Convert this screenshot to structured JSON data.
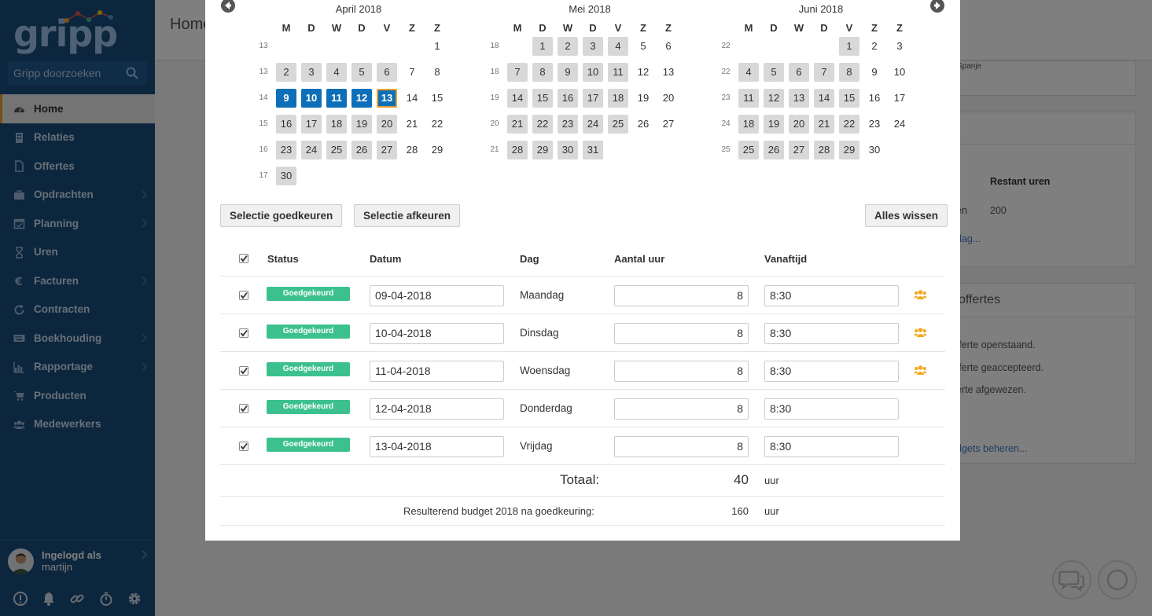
{
  "app": {
    "logo": "gripp",
    "search_placeholder": "Gripp doorzoeken"
  },
  "sidebar": {
    "items": [
      {
        "label": "Home",
        "icon": "dashboard-icon",
        "active": true
      },
      {
        "label": "Relaties",
        "icon": "building-icon"
      },
      {
        "label": "Offertes",
        "icon": "file-icon"
      },
      {
        "label": "Opdrachten",
        "icon": "briefcase-icon",
        "has_sub": true
      },
      {
        "label": "Planning",
        "icon": "calendar-icon",
        "has_sub": true
      },
      {
        "label": "Uren",
        "icon": "hourglass-icon"
      },
      {
        "label": "Facturen",
        "icon": "euro-icon",
        "has_sub": true
      },
      {
        "label": "Contracten",
        "icon": "refresh-icon"
      },
      {
        "label": "Boekhouding",
        "icon": "keyboard-icon",
        "has_sub": true
      },
      {
        "label": "Rapportage",
        "icon": "bar-chart-icon",
        "has_sub": true
      },
      {
        "label": "Producten",
        "icon": "cart-icon"
      },
      {
        "label": "Medewerkers",
        "icon": "users-icon"
      }
    ],
    "user": {
      "line1": "Ingelogd als",
      "line2": "martijn"
    },
    "bottom_icons": [
      "exclamation-icon",
      "bell-icon",
      "link-icon",
      "stopwatch-icon",
      "gear-icon"
    ]
  },
  "background": {
    "page_title": "Home",
    "snippets": {
      "spanje": "Spanje",
      "restant_header": "Restant uren",
      "en": "en",
      "restant_value": "200",
      "dag_link": "dag...",
      "offertes_title": "offertes",
      "open": "fferte openstaand.",
      "accepted": "fferte geaccepteerd.",
      "rejected": "erte afgewezen.",
      "budgets_link": "dgets beheren..."
    }
  },
  "calendars": [
    {
      "title": "April 2018",
      "dow": [
        "M",
        "D",
        "W",
        "D",
        "V",
        "Z",
        "Z"
      ],
      "weeks": [
        {
          "wk": "13",
          "days": [
            null,
            null,
            null,
            null,
            null,
            null,
            {
              "d": "1"
            }
          ]
        },
        {
          "wk": "13",
          "days": [
            {
              "d": "2",
              "s": "g"
            },
            {
              "d": "3",
              "s": "g"
            },
            {
              "d": "4",
              "s": "g"
            },
            {
              "d": "5",
              "s": "g"
            },
            {
              "d": "6",
              "s": "g"
            },
            {
              "d": "7"
            },
            {
              "d": "8"
            }
          ]
        },
        {
          "wk": "14",
          "days": [
            {
              "d": "9",
              "s": "sel"
            },
            {
              "d": "10",
              "s": "sel"
            },
            {
              "d": "11",
              "s": "sel"
            },
            {
              "d": "12",
              "s": "sel"
            },
            {
              "d": "13",
              "s": "cur"
            },
            {
              "d": "14"
            },
            {
              "d": "15"
            }
          ]
        },
        {
          "wk": "15",
          "days": [
            {
              "d": "16",
              "s": "g"
            },
            {
              "d": "17",
              "s": "g"
            },
            {
              "d": "18",
              "s": "g"
            },
            {
              "d": "19",
              "s": "g"
            },
            {
              "d": "20",
              "s": "g"
            },
            {
              "d": "21"
            },
            {
              "d": "22"
            }
          ]
        },
        {
          "wk": "16",
          "days": [
            {
              "d": "23",
              "s": "g"
            },
            {
              "d": "24",
              "s": "g"
            },
            {
              "d": "25",
              "s": "g"
            },
            {
              "d": "26",
              "s": "g"
            },
            {
              "d": "27",
              "s": "g"
            },
            {
              "d": "28"
            },
            {
              "d": "29"
            }
          ]
        },
        {
          "wk": "17",
          "days": [
            {
              "d": "30",
              "s": "g"
            }
          ]
        }
      ]
    },
    {
      "title": "Mei 2018",
      "dow": [
        "M",
        "D",
        "W",
        "D",
        "V",
        "Z",
        "Z"
      ],
      "weeks": [
        {
          "wk": "18",
          "days": [
            null,
            {
              "d": "1",
              "s": "g"
            },
            {
              "d": "2",
              "s": "g"
            },
            {
              "d": "3",
              "s": "g"
            },
            {
              "d": "4",
              "s": "g"
            },
            {
              "d": "5"
            },
            {
              "d": "6"
            }
          ]
        },
        {
          "wk": "18",
          "days": [
            {
              "d": "7",
              "s": "g"
            },
            {
              "d": "8",
              "s": "g"
            },
            {
              "d": "9",
              "s": "g"
            },
            {
              "d": "10",
              "s": "g"
            },
            {
              "d": "11",
              "s": "g"
            },
            {
              "d": "12"
            },
            {
              "d": "13"
            }
          ]
        },
        {
          "wk": "19",
          "days": [
            {
              "d": "14",
              "s": "g"
            },
            {
              "d": "15",
              "s": "g"
            },
            {
              "d": "16",
              "s": "g"
            },
            {
              "d": "17",
              "s": "g"
            },
            {
              "d": "18",
              "s": "g"
            },
            {
              "d": "19"
            },
            {
              "d": "20"
            }
          ]
        },
        {
          "wk": "20",
          "days": [
            {
              "d": "21",
              "s": "g"
            },
            {
              "d": "22",
              "s": "g"
            },
            {
              "d": "23",
              "s": "g"
            },
            {
              "d": "24",
              "s": "g"
            },
            {
              "d": "25",
              "s": "g"
            },
            {
              "d": "26"
            },
            {
              "d": "27"
            }
          ]
        },
        {
          "wk": "21",
          "days": [
            {
              "d": "28",
              "s": "g"
            },
            {
              "d": "29",
              "s": "g"
            },
            {
              "d": "30",
              "s": "g"
            },
            {
              "d": "31",
              "s": "g"
            }
          ]
        }
      ]
    },
    {
      "title": "Juni 2018",
      "dow": [
        "M",
        "D",
        "W",
        "D",
        "V",
        "Z",
        "Z"
      ],
      "weeks": [
        {
          "wk": "22",
          "days": [
            null,
            null,
            null,
            null,
            {
              "d": "1",
              "s": "g"
            },
            {
              "d": "2"
            },
            {
              "d": "3"
            }
          ]
        },
        {
          "wk": "22",
          "days": [
            {
              "d": "4",
              "s": "g"
            },
            {
              "d": "5",
              "s": "g"
            },
            {
              "d": "6",
              "s": "g"
            },
            {
              "d": "7",
              "s": "g"
            },
            {
              "d": "8",
              "s": "g"
            },
            {
              "d": "9"
            },
            {
              "d": "10"
            }
          ]
        },
        {
          "wk": "23",
          "days": [
            {
              "d": "11",
              "s": "g"
            },
            {
              "d": "12",
              "s": "g"
            },
            {
              "d": "13",
              "s": "g"
            },
            {
              "d": "14",
              "s": "g"
            },
            {
              "d": "15",
              "s": "g"
            },
            {
              "d": "16"
            },
            {
              "d": "17"
            }
          ]
        },
        {
          "wk": "24",
          "days": [
            {
              "d": "18",
              "s": "g"
            },
            {
              "d": "19",
              "s": "g"
            },
            {
              "d": "20",
              "s": "g"
            },
            {
              "d": "21",
              "s": "g"
            },
            {
              "d": "22",
              "s": "g"
            },
            {
              "d": "23"
            },
            {
              "d": "24"
            }
          ]
        },
        {
          "wk": "25",
          "days": [
            {
              "d": "25",
              "s": "g"
            },
            {
              "d": "26",
              "s": "g"
            },
            {
              "d": "27",
              "s": "g"
            },
            {
              "d": "28",
              "s": "g"
            },
            {
              "d": "29",
              "s": "g"
            },
            {
              "d": "30"
            }
          ]
        }
      ]
    }
  ],
  "buttons": {
    "approve": "Selectie goedkeuren",
    "reject": "Selectie afkeuren",
    "clear": "Alles wissen"
  },
  "table": {
    "headers": {
      "status": "Status",
      "date": "Datum",
      "day": "Dag",
      "hours": "Aantal uur",
      "from": "Vanaftijd"
    },
    "rows": [
      {
        "status": "Goedgekeurd",
        "date": "09-04-2018",
        "day": "Maandag",
        "hours": "8",
        "from": "8:30",
        "group_icon": true
      },
      {
        "status": "Goedgekeurd",
        "date": "10-04-2018",
        "day": "Dinsdag",
        "hours": "8",
        "from": "8:30",
        "group_icon": true
      },
      {
        "status": "Goedgekeurd",
        "date": "11-04-2018",
        "day": "Woensdag",
        "hours": "8",
        "from": "8:30",
        "group_icon": true
      },
      {
        "status": "Goedgekeurd",
        "date": "12-04-2018",
        "day": "Donderdag",
        "hours": "8",
        "from": "8:30",
        "group_icon": false
      },
      {
        "status": "Goedgekeurd",
        "date": "13-04-2018",
        "day": "Vrijdag",
        "hours": "8",
        "from": "8:30",
        "group_icon": false
      }
    ],
    "total_label": "Totaal:",
    "total_value": "40",
    "total_unit": "uur",
    "budget_label": "Resulterend budget 2018 na goedkeuring:",
    "budget_value": "160",
    "budget_unit": "uur"
  },
  "colors": {
    "sidebar": "#184c7c",
    "selected_day": "#0d6fb8",
    "current_day_border": "#e8a030",
    "badge": "#3cc18e",
    "group_icon": "#f0a820"
  }
}
